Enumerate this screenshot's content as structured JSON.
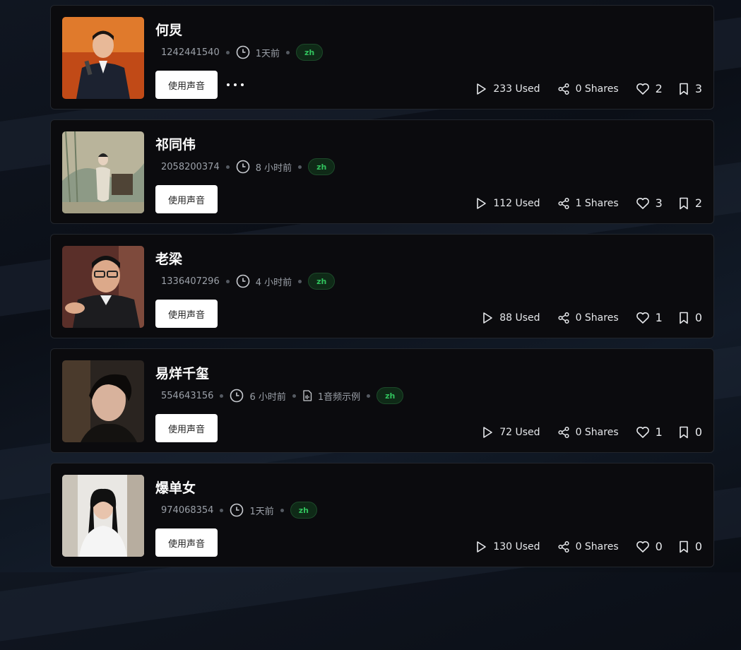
{
  "cards": [
    {
      "name": "何炅",
      "id": "1242441540",
      "time": "1天前",
      "lang": "zh",
      "use_label": "使用声音",
      "used": "233 Used",
      "shares": "0 Shares",
      "likes": "2",
      "saves": "3",
      "show_more": true,
      "avatar": "man-red-stage"
    },
    {
      "name": "祁同伟",
      "id": "2058200374",
      "time": "8 小时前",
      "lang": "zh",
      "use_label": "使用声音",
      "used": "112 Used",
      "shares": "1 Shares",
      "likes": "3",
      "saves": "2",
      "avatar": "painting-woman"
    },
    {
      "name": "老梁",
      "id": "1336407296",
      "time": "4 小时前",
      "lang": "zh",
      "use_label": "使用声音",
      "used": "88 Used",
      "shares": "0 Shares",
      "likes": "1",
      "saves": "0",
      "avatar": "older-man-glasses"
    },
    {
      "name": "易烊千玺",
      "id": "554643156",
      "time": "6 小时前",
      "samples": "1音频示例",
      "lang": "zh",
      "use_label": "使用声音",
      "used": "72 Used",
      "shares": "0 Shares",
      "likes": "1",
      "saves": "0",
      "avatar": "young-man-dark"
    },
    {
      "name": "爆单女",
      "id": "974068354",
      "time": "1天前",
      "lang": "zh",
      "use_label": "使用声音",
      "used": "130 Used",
      "shares": "0 Shares",
      "likes": "0",
      "saves": "0",
      "avatar": "young-woman-room"
    }
  ],
  "colors": {
    "badge_text": "#31c25d",
    "card_bg": "#0b0b0e",
    "accent": "#ffffff"
  }
}
